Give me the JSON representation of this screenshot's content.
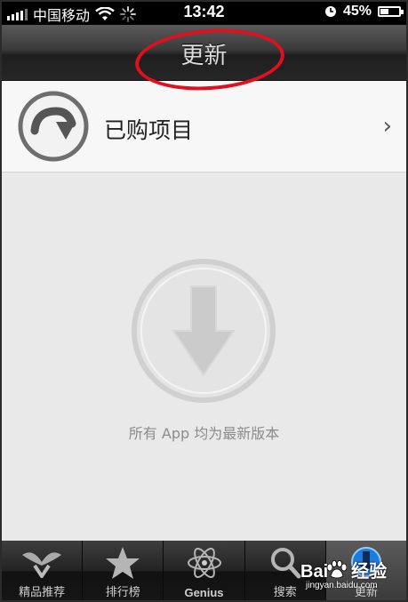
{
  "status_bar": {
    "carrier": "中国移动",
    "time": "13:42",
    "battery_percent": "45%",
    "battery_level": 0.45,
    "icons": [
      "signal-bars-icon",
      "wifi-icon",
      "activity-spinner-icon",
      "clock-icon",
      "battery-icon"
    ]
  },
  "nav": {
    "title": "更新"
  },
  "purchased_row": {
    "label": "已购项目",
    "icon": "purchased-circle-arrow-icon",
    "chevron": "›"
  },
  "empty_state": {
    "message": "所有 App 均为最新版本",
    "icon": "download-arrow-circle-icon"
  },
  "tabs": [
    {
      "label": "精品推荐",
      "icon": "featured-icon",
      "active": false
    },
    {
      "label": "排行榜",
      "icon": "star-icon",
      "active": false
    },
    {
      "label": "Genius",
      "icon": "atom-icon",
      "active": false
    },
    {
      "label": "搜索",
      "icon": "search-icon",
      "active": false
    },
    {
      "label": "更新",
      "icon": "updates-download-icon",
      "active": true
    }
  ],
  "watermark": {
    "main": "Bai",
    "suffix": "经验",
    "sub": "jingyan.baidu.com"
  },
  "colors": {
    "annotation": "#e0101e",
    "badge_blue": "#1a7de0"
  }
}
